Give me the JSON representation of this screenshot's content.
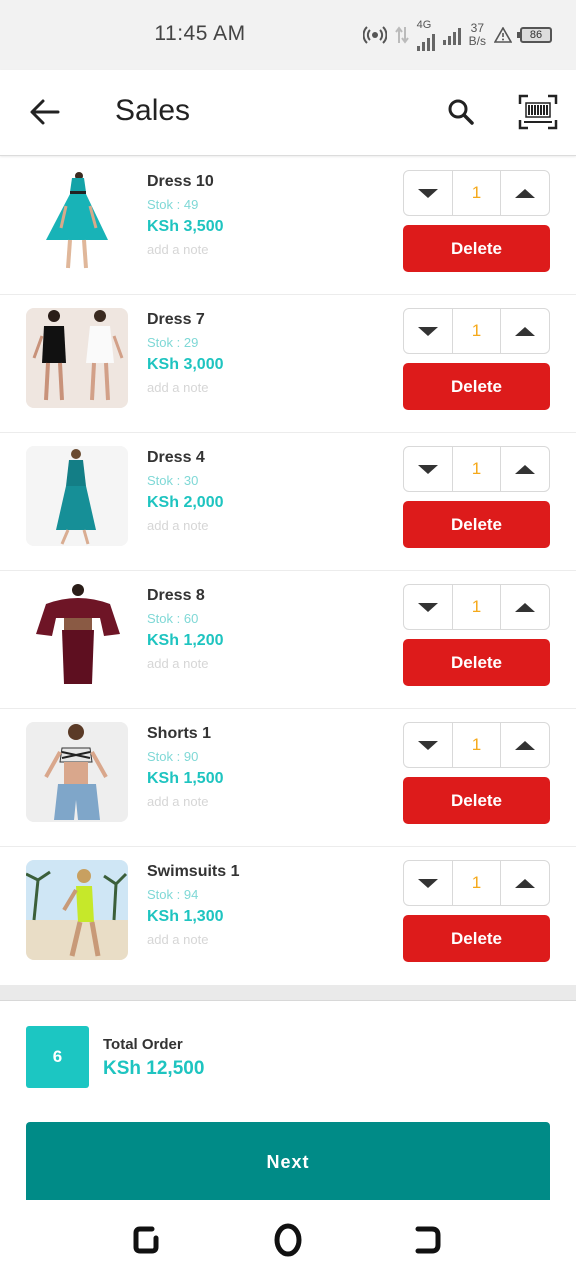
{
  "status_bar": {
    "time": "11:45 AM",
    "network": "4G",
    "speed_value": "37",
    "speed_unit": "B/s",
    "battery": "86"
  },
  "app_bar": {
    "title": "Sales",
    "icons": [
      "back-arrow-icon",
      "search-icon",
      "barcode-scan-icon"
    ]
  },
  "items": [
    {
      "name": "Dress 10",
      "stock": "Stok : 49",
      "price": "KSh 3,500",
      "note": "add a note",
      "qty": "1",
      "delete": "Delete"
    },
    {
      "name": "Dress 7",
      "stock": "Stok : 29",
      "price": "KSh 3,000",
      "note": "add a note",
      "qty": "1",
      "delete": "Delete"
    },
    {
      "name": "Dress 4",
      "stock": "Stok : 30",
      "price": "KSh 2,000",
      "note": "add a note",
      "qty": "1",
      "delete": "Delete"
    },
    {
      "name": "Dress 8",
      "stock": "Stok : 60",
      "price": "KSh 1,200",
      "note": "add a note",
      "qty": "1",
      "delete": "Delete"
    },
    {
      "name": "Shorts 1",
      "stock": "Stok : 90",
      "price": "KSh 1,500",
      "note": "add a note",
      "qty": "1",
      "delete": "Delete"
    },
    {
      "name": "Swimsuits 1",
      "stock": "Stok : 94",
      "price": "KSh 1,300",
      "note": "add a note",
      "qty": "1",
      "delete": "Delete"
    }
  ],
  "footer": {
    "count": "6",
    "total_label": "Total Order",
    "total_value": "KSh 12,500",
    "next_label": "Next"
  },
  "colors": {
    "accent": "#1ec4c0",
    "next_button": "#008b87",
    "delete_button": "#dd1b1b",
    "qty_text": "#f5a91b"
  }
}
